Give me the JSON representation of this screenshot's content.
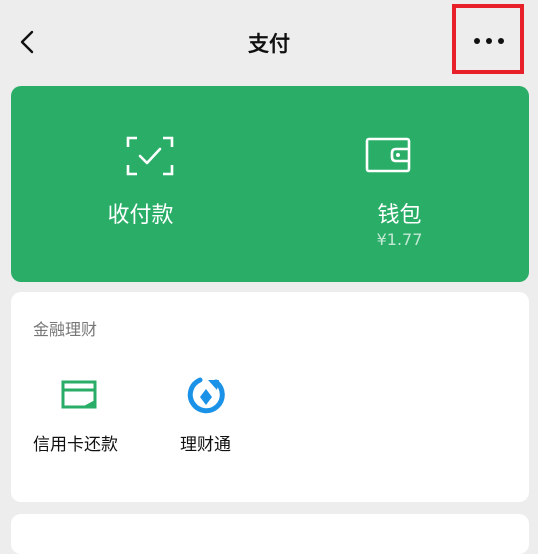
{
  "header": {
    "title": "支付"
  },
  "pay_card": {
    "receive": {
      "label": "收付款"
    },
    "wallet": {
      "label": "钱包",
      "balance": "¥1.77"
    }
  },
  "finance": {
    "title": "金融理财",
    "items": [
      {
        "label": "信用卡还款",
        "icon": "credit-card-icon"
      },
      {
        "label": "理财通",
        "icon": "wealth-icon"
      }
    ]
  },
  "colors": {
    "brand_green": "#2aae67",
    "highlight": "#e8202a"
  }
}
